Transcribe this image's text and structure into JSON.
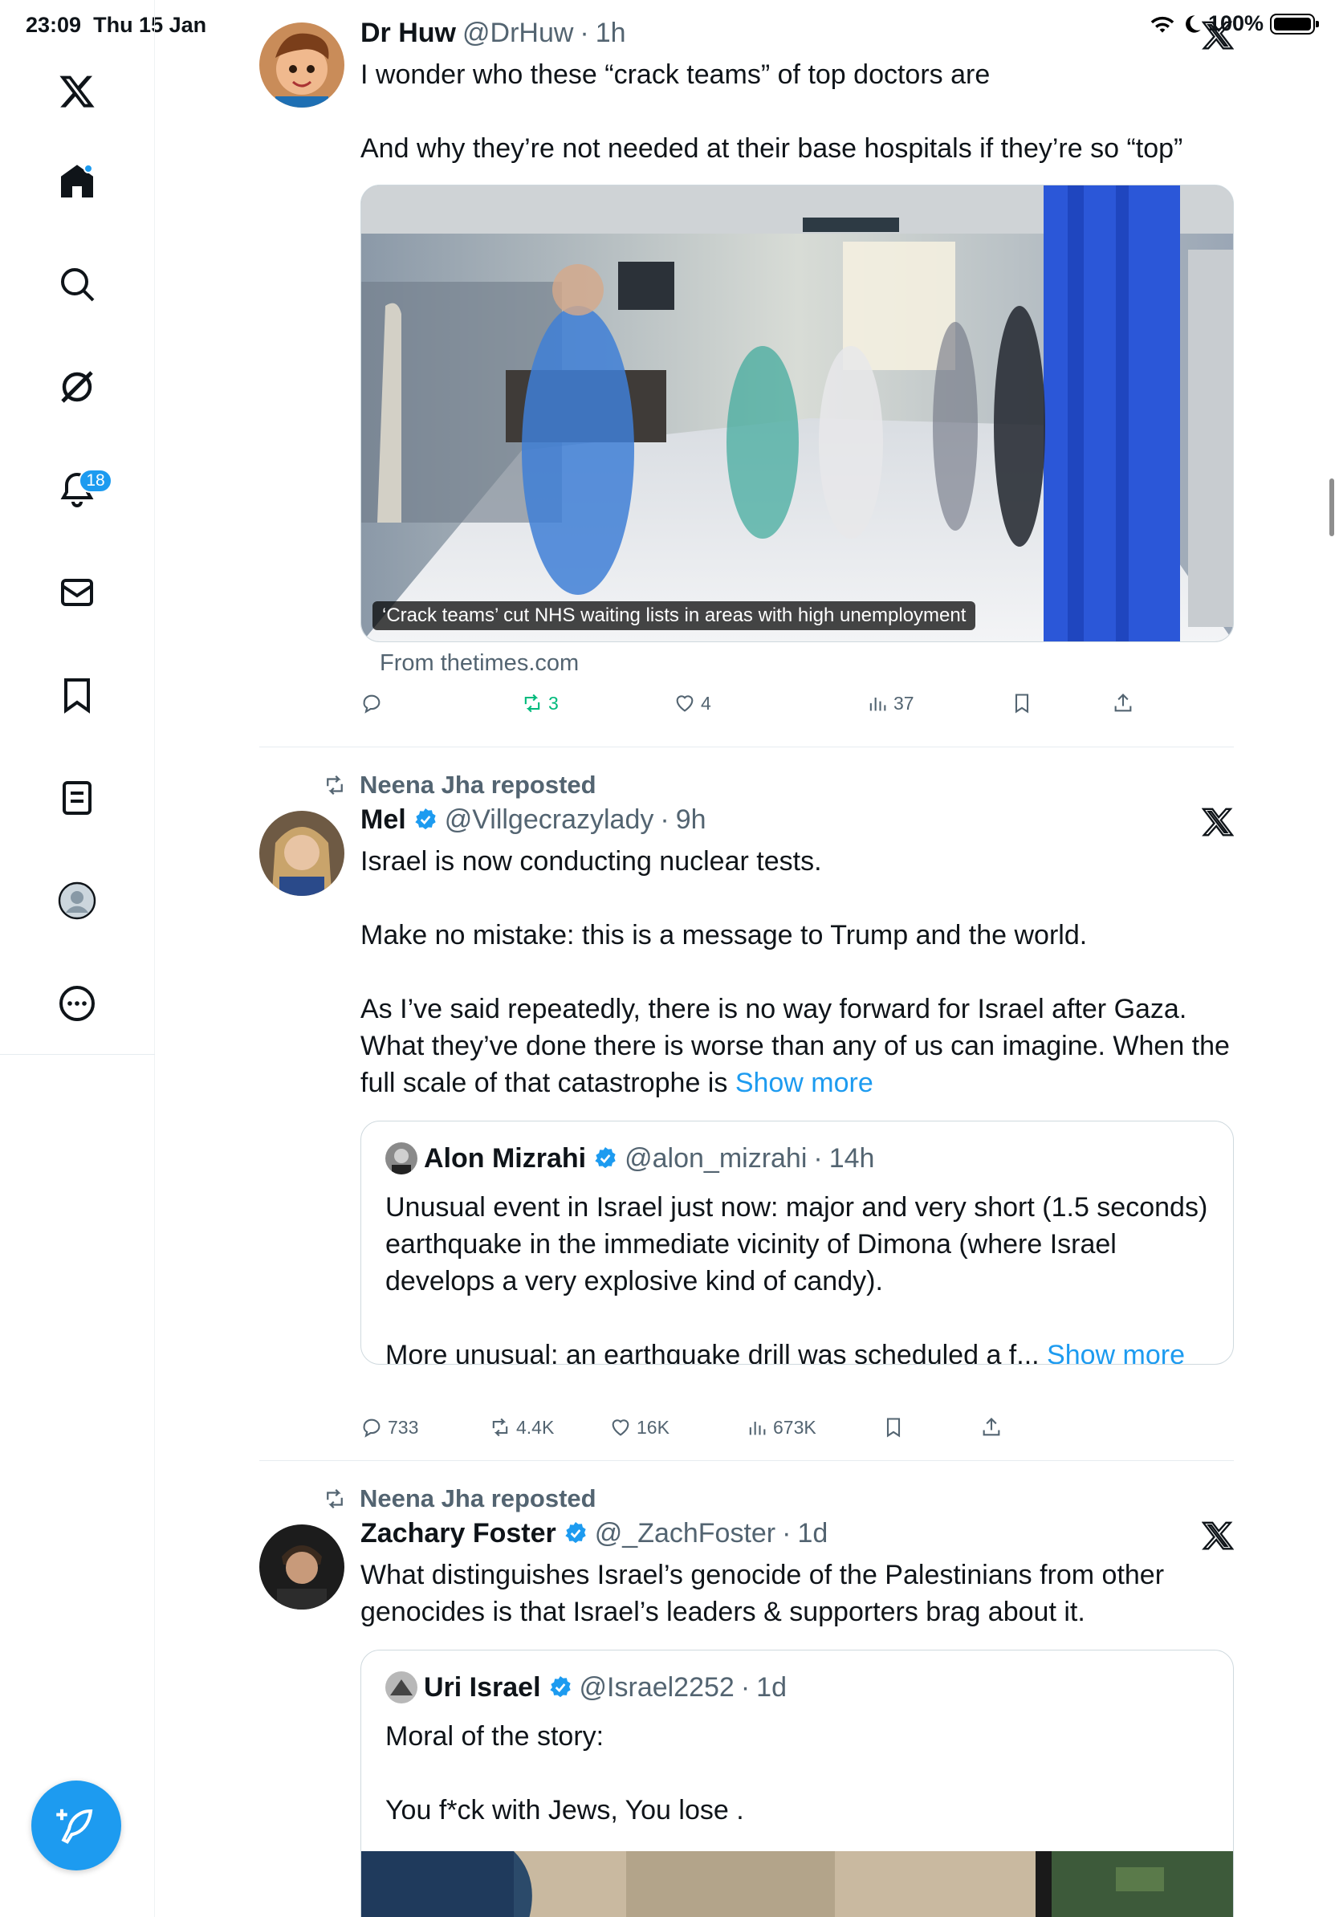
{
  "status": {
    "time": "23:09",
    "date": "Thu 15 Jan",
    "battery": "100%"
  },
  "sidebar": {
    "items": [
      {
        "name": "x-logo"
      },
      {
        "name": "home"
      },
      {
        "name": "search"
      },
      {
        "name": "grok"
      },
      {
        "name": "notifications",
        "badge": "18"
      },
      {
        "name": "messages"
      },
      {
        "name": "bookmarks"
      },
      {
        "name": "lists"
      },
      {
        "name": "profile"
      },
      {
        "name": "more"
      }
    ]
  },
  "posts": [
    {
      "name": "Dr Huw",
      "handle": "@DrHuw",
      "time": "1h",
      "text": "I wonder who these “crack teams” of top doctors are\n\nAnd why they’re not needed at their base hospitals if they’re so “top”",
      "media_caption": "‘Crack teams’ cut NHS waiting lists in areas with high unemployment",
      "source": "From thetimes.com",
      "stats": {
        "reposts": "3",
        "likes": "4",
        "views": "37"
      }
    },
    {
      "reposted_by": "Neena Jha reposted",
      "name": "Mel",
      "handle": "@Villgecrazylady",
      "time": "9h",
      "text": "Israel is now conducting nuclear tests.\n\nMake no mistake: this is a message to Trump and the world.\n\nAs I’ve said repeatedly, there is no way forward for Israel after Gaza. What they’ve done there is worse than any of us can imagine. When the full scale of that catastrophe is ",
      "show_more": "Show more",
      "quote": {
        "name": "Alon Mizrahi",
        "handle": "@alon_mizrahi",
        "time": "14h",
        "text": "Unusual event in Israel just now: major and very short (1.5 seconds) earthquake in the immediate vicinity of Dimona (where Israel develops a very explosive kind of candy).\n\nMore unusual: an earthquake drill was scheduled a f... ",
        "show_more": "Show more"
      },
      "stats": {
        "replies": "733",
        "reposts": "4.4K",
        "likes": "16K",
        "views": "673K"
      }
    },
    {
      "reposted_by": "Neena Jha reposted",
      "name": "Zachary Foster",
      "handle": "@_ZachFoster",
      "time": "1d",
      "text": "What distinguishes Israel’s genocide of the Palestinians from other genocides is that Israel’s leaders & supporters brag about it.",
      "quote": {
        "name": "Uri Israel",
        "handle": "@Israel2252",
        "time": "1d",
        "text": "Moral of the story:\n\nYou f*ck with Jews, You lose ."
      }
    }
  ],
  "colors": {
    "accent": "#1d9bf0",
    "muted": "#536471",
    "repost_active": "#00ba7c"
  }
}
